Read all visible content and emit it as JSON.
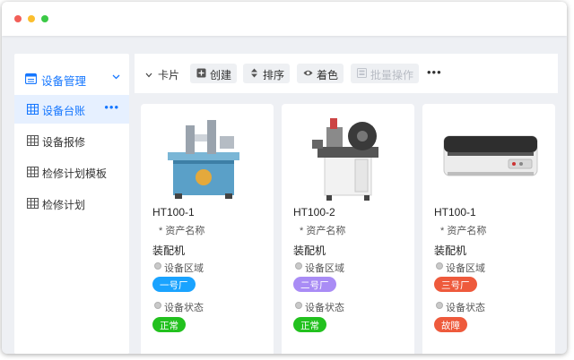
{
  "sidebar": {
    "group_label": "设备管理",
    "items": [
      {
        "label": "设备台账",
        "active": true,
        "more": "•••"
      },
      {
        "label": "设备报修"
      },
      {
        "label": "检修计划模板"
      },
      {
        "label": "检修计划"
      }
    ]
  },
  "toolbar": {
    "view_label": "卡片",
    "create_label": "创建",
    "sort_label": "排序",
    "color_label": "着色",
    "batch_label": "批量操作",
    "more_label": "•••"
  },
  "cards": [
    {
      "code": "HT100-1",
      "field_label": "* 资产名称",
      "type": "装配机",
      "area_label": "设备区域",
      "area": "一号厂",
      "area_color": "#1aa3ff",
      "status_label": "设备状态",
      "status": "正常",
      "status_color": "#22c11e"
    },
    {
      "code": "HT100-2",
      "field_label": "* 资产名称",
      "type": "装配机",
      "area_label": "设备区域",
      "area": "二号厂",
      "area_color": "#a98cf5",
      "status_label": "设备状态",
      "status": "正常",
      "status_color": "#22c11e"
    },
    {
      "code": "HT100-1",
      "field_label": "* 资产名称",
      "type": "装配机",
      "area_label": "设备区域",
      "area": "三号厂",
      "area_color": "#ee5a3c",
      "status_label": "设备状态",
      "status": "故障",
      "status_color": "#ee5a3c"
    }
  ],
  "colors": {
    "accent": "#1677ff",
    "active_bg": "#e6f0ff"
  }
}
